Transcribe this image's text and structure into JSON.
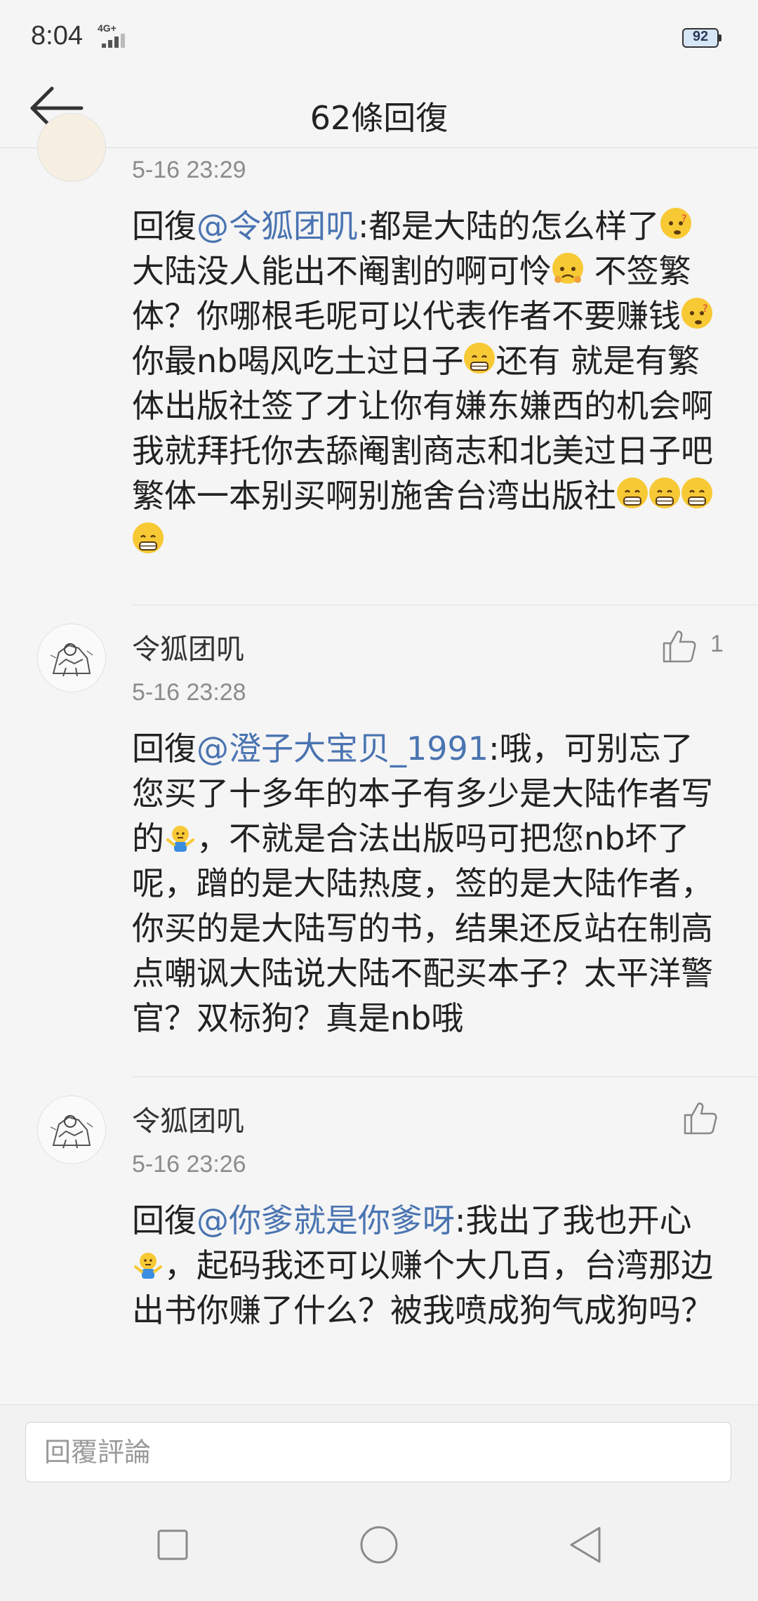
{
  "status_bar": {
    "time": "8:04",
    "network": "4G+",
    "battery": "92"
  },
  "header": {
    "title": "62條回復"
  },
  "comments": [
    {
      "timestamp": "5-16 23:29",
      "body": {
        "prefix": "回復",
        "mention": "@令狐团叽",
        "part1": ":都是大陆的怎么样了",
        "part2": "大陆没人能出不阉割的啊可怜",
        "part3": " 不签繁体？你哪根毛呢可以代表作者不要赚钱",
        "part4": "你最nb喝风吃土过日子",
        "part5": "还有 就是有繁体出版社签了才让你有嫌东嫌西的机会啊 我就拜托你去舔阉割商志和北美过日子吧 繁体一本别买啊别施舍台湾出版社"
      }
    },
    {
      "username": "令狐团叽",
      "timestamp": "5-16 23:28",
      "likes": "1",
      "body": {
        "prefix": "回復",
        "mention": "@澄子大宝贝_1991",
        "part1": ":哦，可别忘了您买了十多年的本子有多少是大陆作者写的",
        "part2": "，不就是合法出版吗可把您nb坏了呢，蹭的是大陆热度，签的是大陆作者，你买的是大陆写的书，结果还反站在制高点嘲讽大陆说大陆不配买本子？太平洋警官？双标狗？真是nb哦"
      }
    },
    {
      "username": "令狐团叽",
      "timestamp": "5-16 23:26",
      "body": {
        "prefix": "回復",
        "mention": "@你爹就是你爹呀",
        "part1": ":我出了我也开心",
        "part2": "，起码我还可以赚个大几百，台湾那边出书你赚了什么？被我喷成狗气成狗吗？"
      }
    }
  ],
  "reply_input": {
    "placeholder": "回覆評論"
  },
  "icons": {
    "back": "back-arrow-icon",
    "like": "thumbs-up-icon",
    "nav_recent": "square-icon",
    "nav_home": "circle-icon",
    "nav_back": "triangle-back-icon"
  },
  "colors": {
    "mention": "#4a74b1",
    "emoji": "#f7c935"
  }
}
